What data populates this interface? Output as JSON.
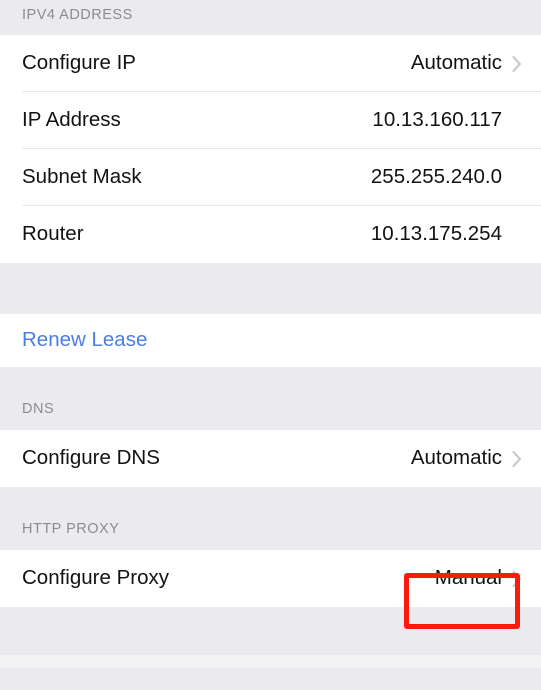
{
  "screen": {
    "name": "wifi-network-details",
    "background_color": "#ebebef",
    "row_background_color": "#ffffff",
    "separator_color": "#e9e9ec",
    "label_color": "#121212",
    "caption_color": "#8b8b91",
    "link_color": "#4a7fe0",
    "chevron_color": "#c9c9cf",
    "highlight_color": "#fb1b0c"
  },
  "sections": [
    {
      "header": "IPV4 ADDRESS",
      "rows": [
        {
          "label": "Configure IP",
          "value": "Automatic",
          "chevron": "chevron-right-icon",
          "style": "value"
        },
        {
          "label": "IP Address",
          "value": "10.13.160.117",
          "chevron": "",
          "style": "value"
        },
        {
          "label": "Subnet Mask",
          "value": "255.255.240.0",
          "chevron": "",
          "style": "value"
        },
        {
          "label": "Router",
          "value": "10.13.175.254",
          "chevron": "",
          "style": "value"
        }
      ]
    },
    {
      "header": "",
      "rows": [
        {
          "label": "Renew Lease",
          "value": "",
          "chevron": "",
          "style": "link"
        }
      ]
    },
    {
      "header": "DNS",
      "rows": [
        {
          "label": "Configure DNS",
          "value": "Automatic",
          "chevron": "chevron-right-icon",
          "style": "value"
        }
      ]
    },
    {
      "header": "HTTP PROXY",
      "rows": [
        {
          "label": "Configure Proxy",
          "value": "Manual",
          "chevron": "chevron-right-icon",
          "style": "value"
        }
      ]
    }
  ],
  "annotation": {
    "target": "Manual",
    "label": "configure-proxy-value-highlight"
  }
}
